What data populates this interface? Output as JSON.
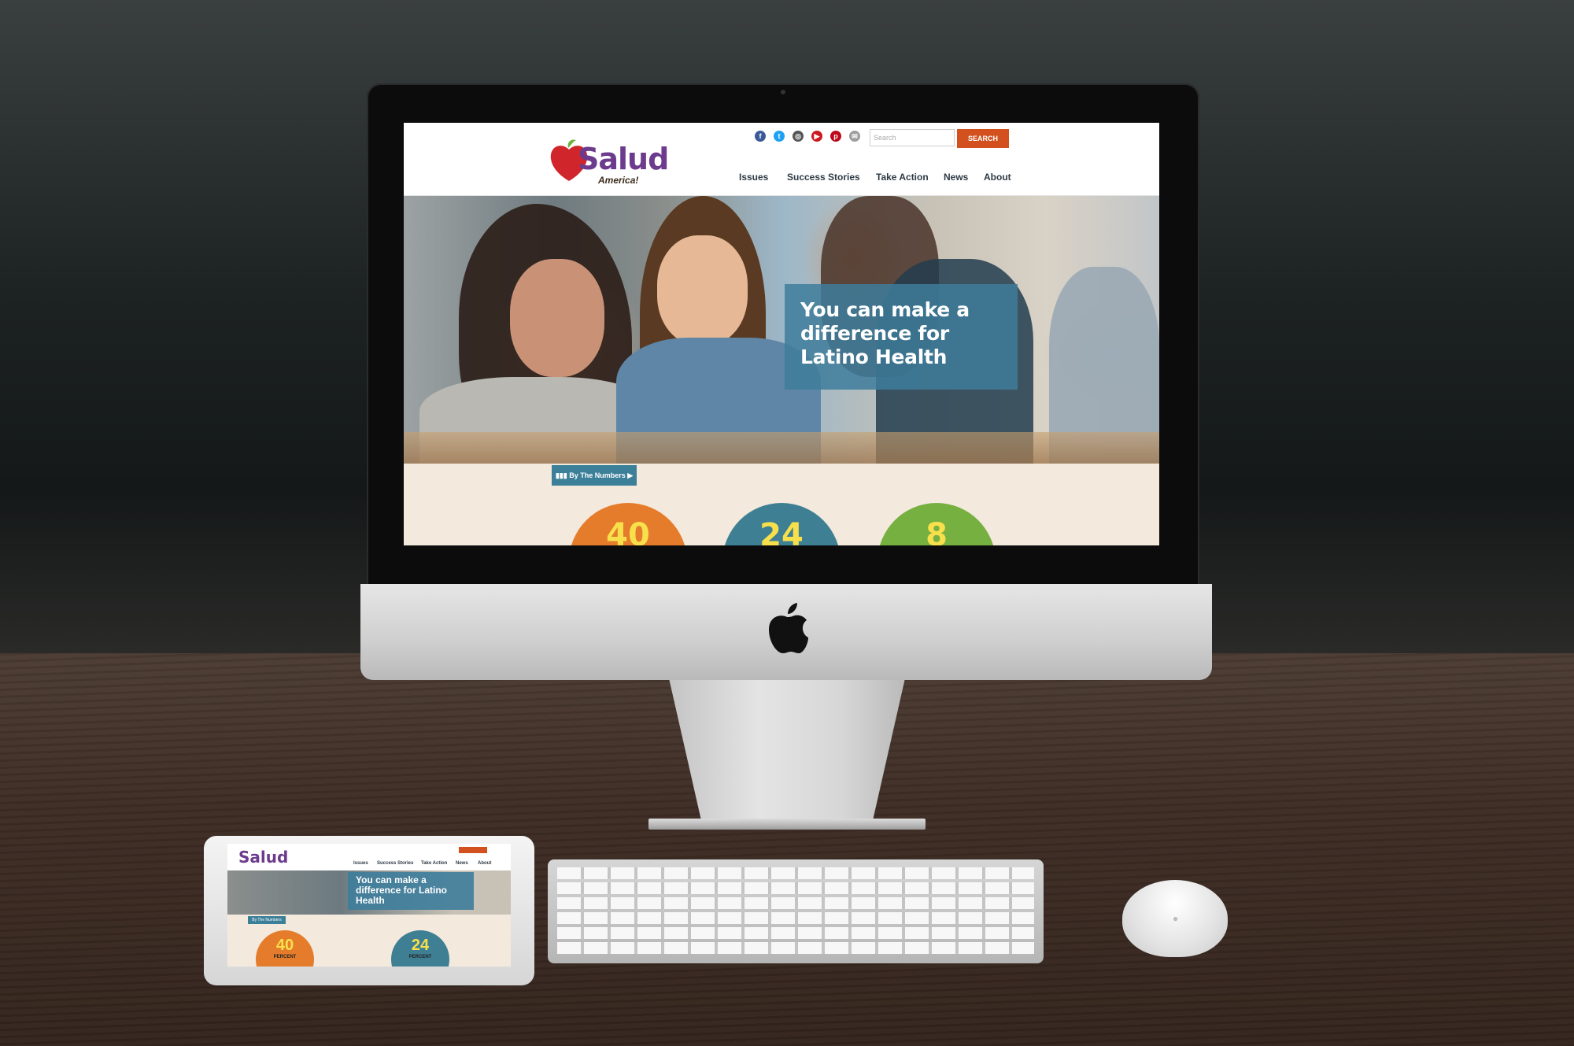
{
  "site": {
    "logo_text": "Salud",
    "logo_subtext": "America!",
    "social_icons": [
      {
        "name": "facebook-icon",
        "color": "#3b5998",
        "glyph": "f"
      },
      {
        "name": "twitter-icon",
        "color": "#1da1f2",
        "glyph": "t"
      },
      {
        "name": "instagram-icon",
        "color": "#555555",
        "glyph": "◎"
      },
      {
        "name": "youtube-icon",
        "color": "#cc181e",
        "glyph": "▶"
      },
      {
        "name": "pinterest-icon",
        "color": "#bd081c",
        "glyph": "p"
      },
      {
        "name": "email-icon",
        "color": "#9e9e9e",
        "glyph": "✉"
      }
    ],
    "search": {
      "placeholder": "Search",
      "button_label": "SEARCH"
    },
    "nav": [
      "Issues",
      "Success Stories",
      "Take Action",
      "News",
      "About"
    ],
    "hero": {
      "headline": "You can make a difference for Latino Health"
    },
    "numbers_button": "By The Numbers",
    "stats": [
      {
        "value": "40",
        "color": "#e57c2b"
      },
      {
        "value": "24",
        "color": "#3f7f93"
      },
      {
        "value": "8",
        "color": "#76b041"
      }
    ]
  },
  "tablet": {
    "logo_text": "Salud",
    "nav": [
      "Issues",
      "Success Stories",
      "Take Action",
      "News",
      "About"
    ],
    "headline": "You can make a difference for Latino Health",
    "numbers_button": "By The Numbers",
    "stats": [
      {
        "value": "40",
        "label": "PERCENT",
        "color": "#e57c2b"
      },
      {
        "value": "24",
        "label": "PERCENT",
        "color": "#3f7f93"
      }
    ]
  },
  "accent_colors": {
    "brand_orange": "#d2511f",
    "teal": "#3c7f98",
    "purple": "#6c3b8d"
  }
}
